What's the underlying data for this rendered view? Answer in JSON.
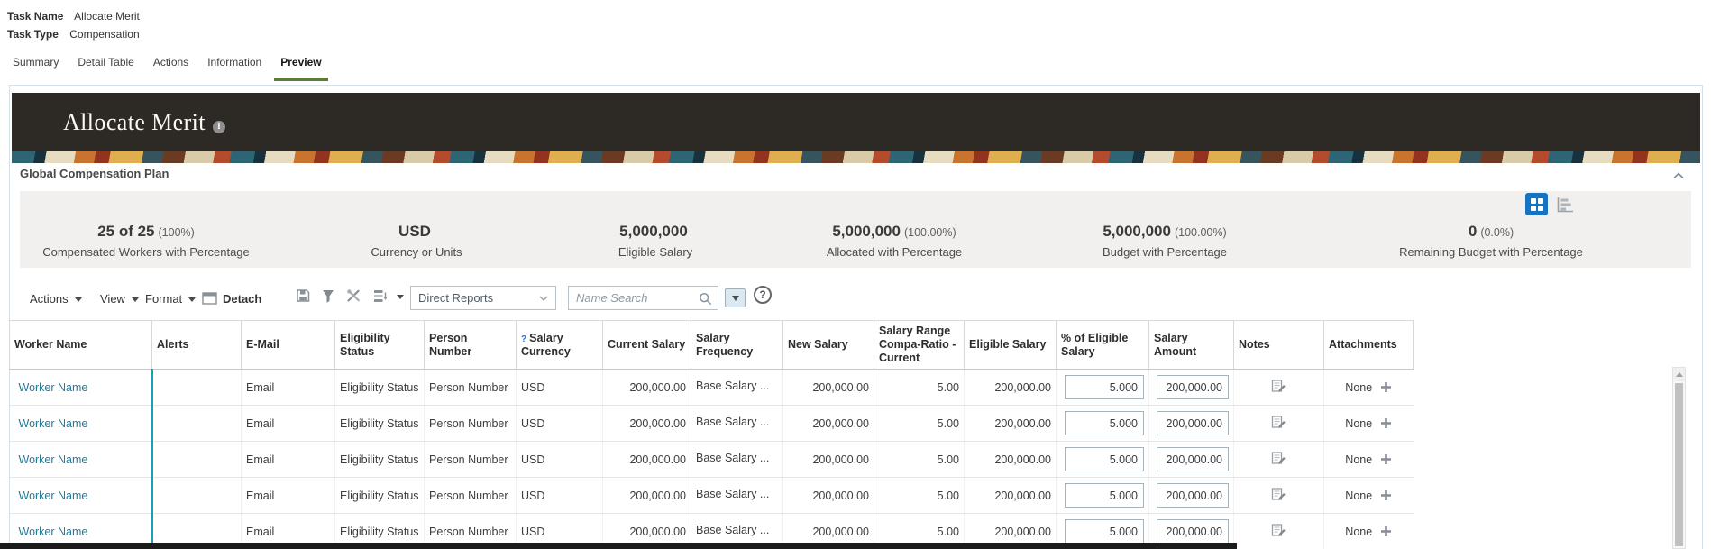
{
  "header": {
    "task_name_label": "Task Name",
    "task_name_value": "Allocate Merit",
    "task_type_label": "Task Type",
    "task_type_value": "Compensation"
  },
  "tabs": [
    {
      "label": "Summary",
      "active": false
    },
    {
      "label": "Detail Table",
      "active": false
    },
    {
      "label": "Actions",
      "active": false
    },
    {
      "label": "Information",
      "active": false
    },
    {
      "label": "Preview",
      "active": true
    }
  ],
  "banner": {
    "title": "Allocate Merit"
  },
  "plan": {
    "section_title": "Global Compensation Plan",
    "stats": [
      {
        "value": "25 of 25",
        "pct": "(100%)",
        "label": "Compensated Workers with Percentage"
      },
      {
        "value": "USD",
        "pct": "",
        "label": "Currency or Units"
      },
      {
        "value": "5,000,000",
        "pct": "",
        "label": "Eligible Salary"
      },
      {
        "value": "5,000,000",
        "pct": "(100.00%)",
        "label": "Allocated with Percentage"
      },
      {
        "value": "5,000,000",
        "pct": "(100.00%)",
        "label": "Budget with Percentage"
      },
      {
        "value": "0",
        "pct": "(0.0%)",
        "label": "Remaining Budget with Percentage"
      }
    ],
    "view_toggle": {
      "selected": "grid",
      "icons": [
        "grid-view-icon",
        "chart-view-icon"
      ]
    }
  },
  "toolbar": {
    "menus": [
      {
        "label": "Actions"
      },
      {
        "label": "View"
      },
      {
        "label": "Format"
      }
    ],
    "detach_label": "Detach",
    "icon_buttons": [
      "export-icon",
      "filter-icon",
      "tools-icon",
      "reorder-columns-icon"
    ],
    "population_select": {
      "value": "Direct Reports"
    },
    "search": {
      "placeholder": "Name Search"
    }
  },
  "table": {
    "columns": [
      {
        "label": "Worker Name"
      },
      {
        "label": "Alerts"
      },
      {
        "label": "E-Mail"
      },
      {
        "label": "Eligibility Status"
      },
      {
        "label": "Person Number"
      },
      {
        "label": "Salary Currency",
        "help_marker": true
      },
      {
        "label": "Current Salary"
      },
      {
        "label": "Salary Frequency"
      },
      {
        "label": "New Salary"
      },
      {
        "label": "Salary Range Compa-Ratio - Current"
      },
      {
        "label": "Eligible Salary"
      },
      {
        "label": "% of Eligible Salary",
        "editable": true
      },
      {
        "label": "Salary Amount",
        "editable": true
      },
      {
        "label": "Notes"
      },
      {
        "label": "Attachments"
      }
    ],
    "rows": [
      {
        "worker_name": "Worker Name",
        "alerts": "",
        "email": "Email",
        "eligibility_status": "Eligibility Status",
        "person_number": "Person Number",
        "salary_currency": "USD",
        "current_salary": "200,000.00",
        "salary_frequency": "Base Salary ...",
        "new_salary": "200,000.00",
        "compa_ratio": "5.00",
        "eligible_salary": "200,000.00",
        "pct_of_eligible": "5.000",
        "salary_amount": "200,000.00",
        "attachments": "None"
      },
      {
        "worker_name": "Worker Name",
        "alerts": "",
        "email": "Email",
        "eligibility_status": "Eligibility Status",
        "person_number": "Person Number",
        "salary_currency": "USD",
        "current_salary": "200,000.00",
        "salary_frequency": "Base Salary ...",
        "new_salary": "200,000.00",
        "compa_ratio": "5.00",
        "eligible_salary": "200,000.00",
        "pct_of_eligible": "5.000",
        "salary_amount": "200,000.00",
        "attachments": "None"
      },
      {
        "worker_name": "Worker Name",
        "alerts": "",
        "email": "Email",
        "eligibility_status": "Eligibility Status",
        "person_number": "Person Number",
        "salary_currency": "USD",
        "current_salary": "200,000.00",
        "salary_frequency": "Base Salary ...",
        "new_salary": "200,000.00",
        "compa_ratio": "5.00",
        "eligible_salary": "200,000.00",
        "pct_of_eligible": "5.000",
        "salary_amount": "200,000.00",
        "attachments": "None"
      },
      {
        "worker_name": "Worker Name",
        "alerts": "",
        "email": "Email",
        "eligibility_status": "Eligibility Status",
        "person_number": "Person Number",
        "salary_currency": "USD",
        "current_salary": "200,000.00",
        "salary_frequency": "Base Salary ...",
        "new_salary": "200,000.00",
        "compa_ratio": "5.00",
        "eligible_salary": "200,000.00",
        "pct_of_eligible": "5.000",
        "salary_amount": "200,000.00",
        "attachments": "None"
      },
      {
        "worker_name": "Worker Name",
        "alerts": "",
        "email": "Email",
        "eligibility_status": "Eligibility Status",
        "person_number": "Person Number",
        "salary_currency": "USD",
        "current_salary": "200,000.00",
        "salary_frequency": "Base Salary ...",
        "new_salary": "200,000.00",
        "compa_ratio": "5.00",
        "eligible_salary": "200,000.00",
        "pct_of_eligible": "5.000",
        "salary_amount": "200,000.00",
        "attachments": "None"
      }
    ]
  },
  "colors": {
    "banner_bg": "#2d2925",
    "tab_underline_green": "#5d7a3c",
    "view_toggle_blue": "#1673c1",
    "frozen_column_line": "#18a0b8",
    "editable_column_bg": "#b7dae6",
    "worker_link": "#1c7d9c",
    "stats_bar_bg": "#f1f0ee"
  }
}
